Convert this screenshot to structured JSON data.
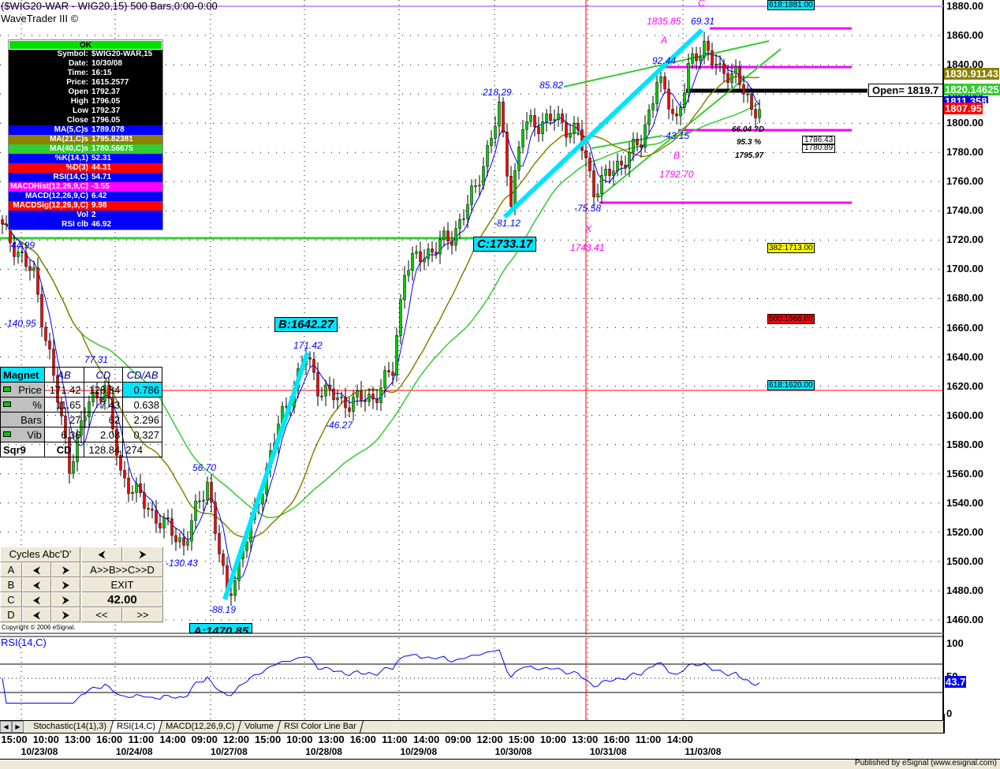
{
  "header": {
    "symbol_line": "($WIG20-WAR - WIG20,15) 500 Bars,0:00-0:00",
    "app_name": "WaveTrader III ©"
  },
  "info_panel": {
    "status": "OK",
    "rows": [
      {
        "k": "Symbol:",
        "v": "$WIG20-WAR,15",
        "bg": "#000000",
        "fg": "#ffffff"
      },
      {
        "k": "Date:",
        "v": "10/30/08",
        "bg": "#000000",
        "fg": "#ffffff"
      },
      {
        "k": "Time:",
        "v": "16:15",
        "bg": "#000000",
        "fg": "#ffffff"
      },
      {
        "k": "Price:",
        "v": "1615.2577",
        "bg": "#000000",
        "fg": "#ffffff"
      },
      {
        "k": "Open",
        "v": "1792.37",
        "bg": "#000000",
        "fg": "#ffffff"
      },
      {
        "k": "High",
        "v": "1796.05",
        "bg": "#000000",
        "fg": "#ffffff"
      },
      {
        "k": "Low",
        "v": "1792.37",
        "bg": "#000000",
        "fg": "#ffffff"
      },
      {
        "k": "Close",
        "v": "1796.05",
        "bg": "#000000",
        "fg": "#ffffff"
      },
      {
        "k": "MA(5,C)s",
        "v": "1789.078",
        "bg": "#0000ff",
        "fg": "#ffffff"
      },
      {
        "k": "MA(21,C)s",
        "v": "1795.82381",
        "bg": "#8b8000",
        "fg": "#ffffff"
      },
      {
        "k": "MA(40,C)s",
        "v": "1780.56675",
        "bg": "#33cc33",
        "fg": "#ffffff"
      },
      {
        "k": "%K(14,1)",
        "v": "52.31",
        "bg": "#0000ff",
        "fg": "#ffffff"
      },
      {
        "k": "%D(3)",
        "v": "44.31",
        "bg": "#ff0000",
        "fg": "#ffffff"
      },
      {
        "k": "RSI(14,C)",
        "v": "54.71",
        "bg": "#0000ff",
        "fg": "#ffffff"
      },
      {
        "k": "MACDHist(12,26,9,C)",
        "v": "-3.55",
        "bg": "#ff00ff",
        "fg": "#ffffff"
      },
      {
        "k": "MACD(12,26,9,C)",
        "v": "6.42",
        "bg": "#0000ff",
        "fg": "#ffffff"
      },
      {
        "k": "MACDSig(12,26,9,C)",
        "v": "9.98",
        "bg": "#ff0000",
        "fg": "#ffffff"
      },
      {
        "k": "Vol",
        "v": "2",
        "bg": "#0000ff",
        "fg": "#ffffff"
      },
      {
        "k": "RSI clb",
        "v": "46.92",
        "bg": "#0000ff",
        "fg": "#ffffff"
      }
    ]
  },
  "magnet_table": {
    "headers": [
      "Magnet",
      "AB",
      "CD",
      "CD/AB"
    ],
    "rows": [
      [
        "Price",
        "171.42",
        "128.84",
        "0.786"
      ],
      [
        "%",
        "11.65",
        "7.43",
        "0.638"
      ],
      [
        "Bars",
        "27",
        "62",
        "2.296"
      ],
      [
        "Vib",
        "6.36",
        "2.08",
        "0.327"
      ],
      [
        "Sqr9",
        "CD",
        "128.84",
        "274"
      ]
    ]
  },
  "cycles_panel": {
    "title": "Cycles Abc'D'",
    "prev": "⮜",
    "next": "⮞",
    "rows": [
      "A",
      "B",
      "C",
      "D"
    ],
    "sequence": "A>>B>>C>>D",
    "exit": "EXIT",
    "value": "42.00",
    "back": "<<",
    "forward": ">>"
  },
  "copyright": "Copyright © 2006 eSignal.",
  "annotations": [
    {
      "text": "1835.85",
      "color": "#ff00ff"
    },
    {
      "text": "69.31",
      "color": "#0000ff"
    },
    {
      "text": "A",
      "color": "#ff00ff"
    },
    {
      "text": "C",
      "color": "#ff00ff"
    },
    {
      "text": "92.44",
      "color": "#0000ff"
    },
    {
      "text": "85.82",
      "color": "#0000ff"
    },
    {
      "text": "218.29",
      "color": "#0000ff"
    },
    {
      "text": "-43.15",
      "color": "#0000ff"
    },
    {
      "text": "B",
      "color": "#ff00ff"
    },
    {
      "text": "1792.70",
      "color": "#ff00ff"
    },
    {
      "text": "66.04 ?D",
      "color": "#000000"
    },
    {
      "text": "95.3 %",
      "color": "#000000"
    },
    {
      "text": "1795.97",
      "color": "#000000"
    },
    {
      "text": "-75.58",
      "color": "#0000ff"
    },
    {
      "text": "X",
      "color": "#ff00ff"
    },
    {
      "text": "1743.41",
      "color": "#ff00ff"
    },
    {
      "text": "-81.12",
      "color": "#0000ff"
    },
    {
      "text": "44.99",
      "color": "#0000ff"
    },
    {
      "text": "-140.95",
      "color": "#0000ff"
    },
    {
      "text": "171.42",
      "color": "#0000ff"
    },
    {
      "text": "77.31",
      "color": "#0000ff"
    },
    {
      "text": "-46.27",
      "color": "#0000ff"
    },
    {
      "text": "56.70",
      "color": "#0000ff"
    },
    {
      "text": "-130.43",
      "color": "#0000ff"
    },
    {
      "text": "-88.19",
      "color": "#0000ff"
    }
  ],
  "wave_boxes": {
    "a": "A:1470.85",
    "b": "B:1642.27",
    "c": "C:1733.17"
  },
  "small_boxes": [
    "1786.43",
    "1780.89"
  ],
  "fib_levels": [
    {
      "text": "618:1881.00",
      "color": "#00e5ff"
    },
    {
      "text": "382:1713.00",
      "color": "#ffff00"
    },
    {
      "text": "500:1666.00",
      "color": "#ff0000"
    },
    {
      "text": "618:1620.00",
      "color": "#00e5ff"
    }
  ],
  "open_label": "Open= 1819.7",
  "price_tags": [
    {
      "text": "1830.91143",
      "bg": "#8b8000",
      "fg": "#ffffff"
    },
    {
      "text": "1820.14625",
      "bg": "#33cc33",
      "fg": "#ffffff"
    },
    {
      "text": "1811.358",
      "bg": "#0000ff",
      "fg": "#ffffff"
    },
    {
      "text": "1807.95",
      "bg": "#ff0000",
      "fg": "#ffffff"
    }
  ],
  "rsi_pane": {
    "label": "RSI(14,C)",
    "axis": [
      "100",
      "50",
      "0"
    ],
    "current": "43.7"
  },
  "tabs": [
    "Stochastic(14(1),3)",
    "RSI(14,C)",
    "MACD(12,26,9,C)",
    "Volume",
    "RSI Color Line Bar"
  ],
  "active_tab": 1,
  "time_labels": [
    "15:00",
    "10:00",
    "13:00",
    "16:00",
    "11:00",
    "14:00",
    "09:00",
    "12:00",
    "15:00",
    "10:00",
    "13:00",
    "16:00",
    "11:00",
    "14:00",
    "09:00",
    "12:00",
    "15:00",
    "10:00",
    "13:00",
    "16:00",
    "11:00",
    "14:00"
  ],
  "date_labels": [
    "10/23/08",
    "10/24/08",
    "10/27/08",
    "10/28/08",
    "10/29/08",
    "10/30/08",
    "10/31/08",
    "11/03/08"
  ],
  "footer": "Published by eSignal (www.esignal.com)",
  "chart_data": {
    "type": "candlestick",
    "title": "($WIG20-WAR - WIG20,15) 500 Bars",
    "ylim": [
      1460,
      1880
    ],
    "ytick_step": 20,
    "yticks": [
      "1880.00",
      "1860.00",
      "1840.00",
      "1820.00",
      "1800.00",
      "1780.00",
      "1760.00",
      "1740.00",
      "1720.00",
      "1700.00",
      "1680.00",
      "1660.00",
      "1640.00",
      "1620.00",
      "1600.00",
      "1580.00",
      "1560.00",
      "1540.00",
      "1520.00",
      "1500.00",
      "1480.00",
      "1460.00"
    ],
    "close_waypoints": [
      [
        0,
        1728
      ],
      [
        4,
        1712
      ],
      [
        8,
        1695
      ],
      [
        12,
        1641
      ],
      [
        17,
        1566
      ],
      [
        22,
        1609
      ],
      [
        26,
        1620
      ],
      [
        30,
        1560
      ],
      [
        38,
        1533
      ],
      [
        46,
        1512
      ],
      [
        52,
        1555
      ],
      [
        57,
        1474
      ],
      [
        64,
        1533
      ],
      [
        70,
        1593
      ],
      [
        77,
        1641
      ],
      [
        80,
        1620
      ],
      [
        86,
        1609
      ],
      [
        94,
        1612
      ],
      [
        99,
        1631
      ],
      [
        102,
        1701
      ],
      [
        108,
        1712
      ],
      [
        114,
        1722
      ],
      [
        120,
        1755
      ],
      [
        126,
        1809
      ],
      [
        129,
        1749
      ],
      [
        132,
        1798
      ],
      [
        140,
        1803
      ],
      [
        146,
        1793
      ],
      [
        150,
        1755
      ],
      [
        156,
        1771
      ],
      [
        162,
        1787
      ],
      [
        166,
        1830
      ],
      [
        171,
        1803
      ],
      [
        174,
        1836
      ],
      [
        178,
        1855
      ],
      [
        182,
        1833
      ],
      [
        186,
        1836
      ],
      [
        190,
        1806
      ],
      [
        192,
        1814
      ]
    ],
    "series": [
      "MA(5,C)",
      "MA(21,C)",
      "MA(40,C)"
    ],
    "series_colors": [
      "#0000ff",
      "#8b8000",
      "#33cc33"
    ],
    "up_color": "#00cc00",
    "down_color": "#ff0000"
  }
}
